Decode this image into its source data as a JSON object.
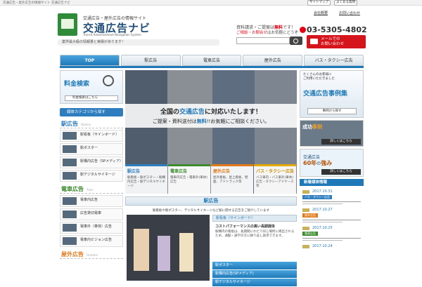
{
  "topbar": {
    "text": "交通広告・屋外広告の情報サイト 交通広告ナビ",
    "sitemap": "サイトマップ",
    "faq": "よくある質問"
  },
  "header": {
    "logo_sub": "交通広告・屋外広告の情報サイト",
    "logo_main": "交通広告ナビ",
    "logo_en": "Transit Advertisement Navigation System",
    "tagline": "業界最大級の情報量と実績があります！",
    "link1": "会社概要",
    "link2": "お問い合わせ",
    "contact_line1_a": "資料請求・ご提案は",
    "contact_line1_b": "無料",
    "contact_line1_c": "です！",
    "contact_line2_a": "ご相談・お問合せ",
    "contact_line2_b": "はお気軽にどうぞ",
    "phone": "03-5305-4802",
    "mail_line1": "メールでの",
    "mail_line2": "お問い合わせ"
  },
  "nav": [
    "TOP",
    "駅広告",
    "電車広告",
    "屋外広告",
    "バス・タクシー広告"
  ],
  "left": {
    "price_title": "料金検索",
    "price_btn": "料金検索はこちら",
    "cat_btn": "媒体カテゴリから探す",
    "sections": [
      {
        "title": "駅広告",
        "en": "Station",
        "items": [
          "駅看板（サインボード）",
          "駅ポスター",
          "駅構内広告（SPメディア）",
          "駅デジタルサイネージ"
        ]
      },
      {
        "title": "電車広告",
        "en": "Train",
        "items": [
          "電車内広告",
          "広告貸切電車",
          "電車外（車体）広告",
          "電車内ビジョン広告"
        ]
      },
      {
        "title": "屋外広告",
        "en": "Outdoor",
        "items": []
      }
    ]
  },
  "banner": {
    "line1_a": "全国の",
    "line1_b": "交通広告",
    "line1_c": "に対応いたします！",
    "line2_a": "ご提案・資料送付は",
    "line2_b": "無料",
    "line2_c": "!!お気軽にご相談ください。",
    "cats": [
      {
        "title": "駅広告",
        "desc": "駅看板・駅ポスター・駅構内広告・駅デジタルサイネージ"
      },
      {
        "title": "電車広告",
        "desc": "電車内広告・電車外(車体)広告"
      },
      {
        "title": "屋外広告",
        "desc": "屋外看板、屋上看板、壁面、アドトラック等"
      },
      {
        "title": "バス・タクシー広告",
        "desc": "バス車内・バス車外(車体)広告・タクシーアドケース等"
      }
    ]
  },
  "section": {
    "title": "駅広告",
    "desc": "駅看板や駅ポスター、デジタルサイネージなど駅に関する広告をご紹介しています",
    "tab": "駅看板（サインボード）",
    "item_title": "コストパフォーマンスの高い長期媒体",
    "item_body": "駅構内の看板は、長期間にわたり同じ場所に掲出されるため、通勤・通学の方に繰り返し訴求できます。",
    "buttons": [
      "駅ポスター",
      "駅構内広告(SPメディア)",
      "駅デジタルサイネージ"
    ]
  },
  "right": {
    "box1_small": "たくさんのお客様に\nご利用いただきました",
    "box1_big": "交通広告事例集",
    "box1_btn": "事例から探す",
    "box2_a": "成功",
    "box2_b": "事例",
    "box2_btn": "詳しくはこちら",
    "box3_a": "交通広告",
    "box3_b": "60年",
    "box3_c": "の",
    "box3_d": "強み",
    "box3_btn": "詳しくはこちら",
    "news_head": "新着媒体情報",
    "news": [
      {
        "date": "2017.10.31",
        "tag": "バス・タクシー広告"
      },
      {
        "date": "2017.10.27",
        "tag": "屋外広告"
      },
      {
        "date": "2017.10.25",
        "tag": "電車広告"
      },
      {
        "date": "2017.10.24",
        "tag": ""
      }
    ]
  },
  "colors": {
    "accent": "#1f79b8",
    "brand_green": "#2f8a3a",
    "alert_red": "#e60012"
  }
}
